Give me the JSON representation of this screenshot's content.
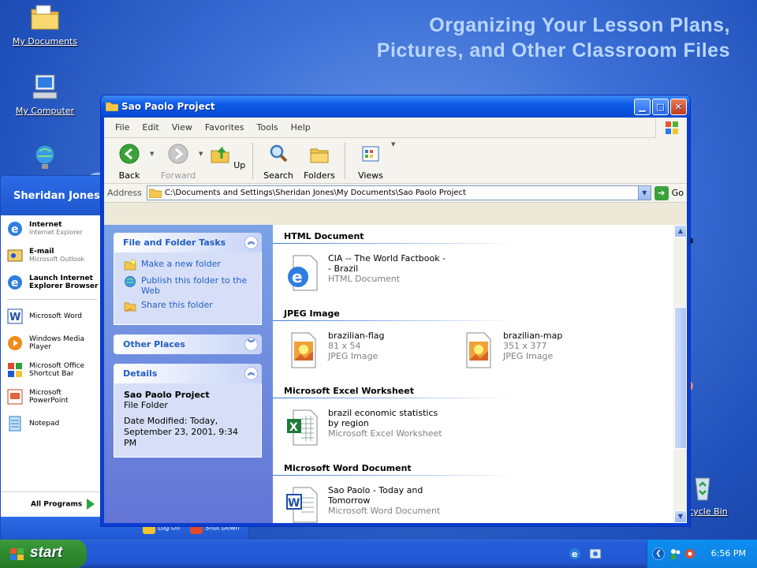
{
  "slide": {
    "title_line1": "Organizing Your Lesson Plans,",
    "title_line2": "Pictures, and Other Classroom Files"
  },
  "desktop": {
    "icons": [
      {
        "label": "My Documents",
        "icon": "my-documents-icon"
      },
      {
        "label": "My Computer",
        "icon": "my-computer-icon"
      },
      {
        "label": "Recycle Bin",
        "icon": "recycle-bin-icon"
      }
    ]
  },
  "start_menu": {
    "user": "Sheridan Jones",
    "pinned": [
      {
        "title": "Internet",
        "sub": "Internet Explorer"
      },
      {
        "title": "E-mail",
        "sub": "Microsoft Outlook"
      },
      {
        "title": "Launch Internet Explorer Browser",
        "sub": ""
      }
    ],
    "recent": [
      {
        "title": "Microsoft Word"
      },
      {
        "title": "Windows Media Player"
      },
      {
        "title": "Microsoft Office Shortcut Bar"
      },
      {
        "title": "Microsoft PowerPoint"
      },
      {
        "title": "Notepad"
      }
    ],
    "all_programs": "All Programs",
    "log_off": "Log Off",
    "shut_down": "Shut Down"
  },
  "window": {
    "title": "Sao Paolo Project",
    "menu": [
      "File",
      "Edit",
      "View",
      "Favorites",
      "Tools",
      "Help"
    ],
    "toolbar": {
      "back": "Back",
      "forward": "Forward",
      "up": "Up",
      "search": "Search",
      "folders": "Folders",
      "views": "Views"
    },
    "address": {
      "label": "Address",
      "value": "C:\\Documents and Settings\\Sheridan Jones\\My Documents\\Sao Paolo Project",
      "go": "Go"
    },
    "tasks": {
      "file_folder_tasks": "File and Folder Tasks",
      "links": [
        "Make a new folder",
        "Publish this folder to the Web",
        "Share this folder"
      ],
      "other_places": "Other Places",
      "details": "Details",
      "details_name": "Sao Paolo Project",
      "details_type": "File Folder",
      "details_modified": "Date Modified: Today, September 23, 2001, 9:34 PM"
    },
    "groups": [
      {
        "heading": "HTML Document",
        "items": [
          {
            "name": "CIA -- The World Factbook -- Brazil",
            "meta1": "HTML Document",
            "meta2": ""
          }
        ]
      },
      {
        "heading": "JPEG Image",
        "items": [
          {
            "name": "brazilian-flag",
            "meta1": "81 x 54",
            "meta2": "JPEG Image"
          },
          {
            "name": "brazilian-map",
            "meta1": "351 x 377",
            "meta2": "JPEG Image"
          }
        ]
      },
      {
        "heading": "Microsoft Excel Worksheet",
        "items": [
          {
            "name": "brazil economic statistics by region",
            "meta1": "Microsoft Excel Worksheet",
            "meta2": ""
          }
        ]
      },
      {
        "heading": "Microsoft Word Document",
        "items": [
          {
            "name": "Sao Paolo - Today and Tomorrow",
            "meta1": "Microsoft Word Document",
            "meta2": ""
          }
        ]
      }
    ]
  },
  "taskbar": {
    "start": "start",
    "clock": "6:56 PM"
  },
  "colors": {
    "xp_blue": "#0a4fd9",
    "task_link": "#215dc6",
    "start_green": "#2f8a2f"
  }
}
